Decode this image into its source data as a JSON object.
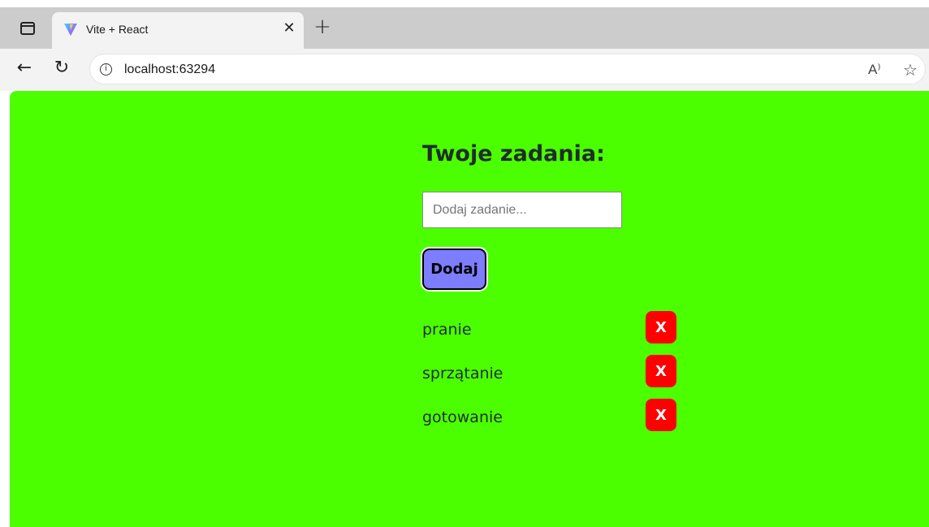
{
  "browser": {
    "tab": {
      "title": "Vite + React",
      "close_glyph": "✕"
    },
    "new_tab_glyph": "+",
    "back_glyph": "←",
    "reload_glyph": "↻",
    "info_glyph": "i",
    "url": "localhost:63294",
    "read_aloud_glyph": "A⁾",
    "favorite_glyph": "☆",
    "icons": [
      "window-icon",
      "vite-logo-icon",
      "close-icon",
      "new-tab-icon",
      "back-arrow-icon",
      "reload-icon",
      "info-icon",
      "read-aloud-icon",
      "favorite-star-icon"
    ]
  },
  "app": {
    "heading": "Twoje zadania:",
    "input": {
      "placeholder": "Dodaj zadanie...",
      "value": ""
    },
    "add_button_label": "Dodaj",
    "tasks": [
      {
        "label": "pranie",
        "delete_label": "X"
      },
      {
        "label": "sprzątanie",
        "delete_label": "X"
      },
      {
        "label": "gotowanie",
        "delete_label": "X"
      }
    ]
  },
  "colors": {
    "page_background": "#4cff00",
    "add_button": "#7d7dff",
    "delete_button": "#ff0000",
    "text": "#1f2d2a"
  }
}
